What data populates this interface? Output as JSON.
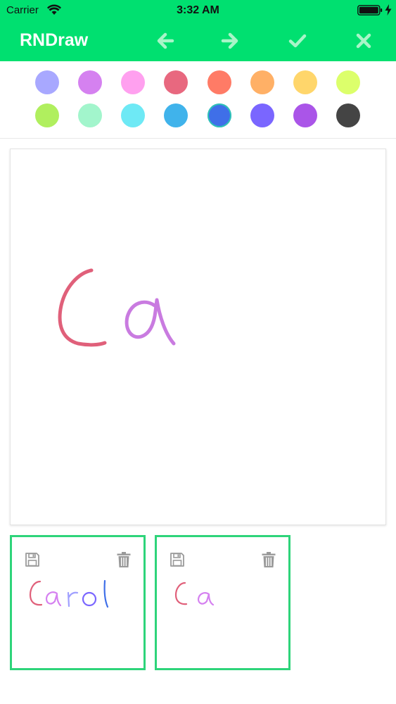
{
  "status_bar": {
    "carrier": "Carrier",
    "time": "3:32 AM"
  },
  "header": {
    "title": "RNDraw",
    "background_color": "#00e070",
    "icons": [
      "arrow-left-icon",
      "arrow-right-icon",
      "checkmark-icon",
      "close-icon"
    ]
  },
  "palette": {
    "colors": [
      "#a8a8ff",
      "#d581f0",
      "#ffa0ef",
      "#e8687f",
      "#ff7b66",
      "#ffb066",
      "#ffd66b",
      "#dcff6b",
      "#b0ef5e",
      "#a2f5cc",
      "#6ee9f5",
      "#40b3eb",
      "#3f6fe8",
      "#7a66ff",
      "#aa55e8",
      "#444444"
    ],
    "selected_index": 12
  },
  "canvas": {
    "strokes_colors": [
      "#e0607a",
      "#c97be0"
    ]
  },
  "saved_drawings": [
    {
      "label": "Carol"
    },
    {
      "label": "Ca"
    }
  ]
}
